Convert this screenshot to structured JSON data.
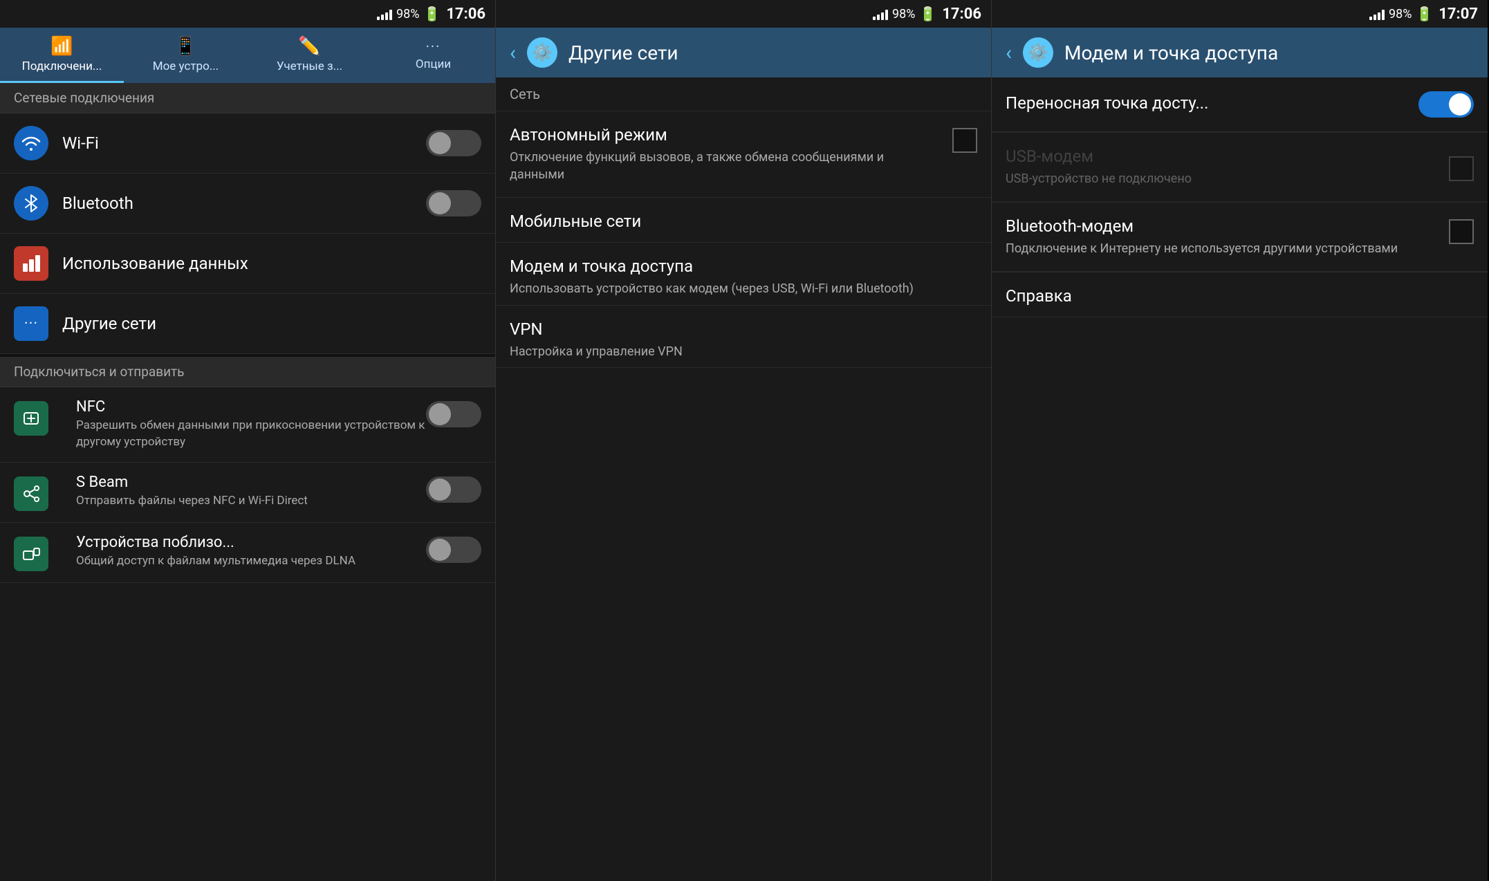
{
  "panel1": {
    "statusBar": {
      "battery": "98%",
      "time": "17:06"
    },
    "tabs": [
      {
        "label": "Подключени...",
        "icon": "📶",
        "active": true
      },
      {
        "label": "Мое устро...",
        "icon": "📱",
        "active": false
      },
      {
        "label": "Учетные з...",
        "icon": "✏️",
        "active": false
      },
      {
        "label": "Опции",
        "icon": "···",
        "active": false
      }
    ],
    "sectionHeader": "Сетевые подключения",
    "items": [
      {
        "title": "Wi-Fi",
        "toggle": true,
        "toggleOn": false
      },
      {
        "title": "Bluetooth",
        "toggle": true,
        "toggleOn": false
      }
    ],
    "dataItem": {
      "title": "Использование данных"
    },
    "otherItem": {
      "title": "Другие сети"
    },
    "connectSection": "Подключиться и отправить",
    "connectItems": [
      {
        "title": "NFC",
        "subtitle": "Разрешить обмен данными при прикосновении устройством к другому устройству",
        "toggle": true,
        "toggleOn": false
      },
      {
        "title": "S Beam",
        "subtitle": "Отправить файлы через NFC и Wi-Fi Direct",
        "toggle": true,
        "toggleOn": false
      },
      {
        "title": "Устройства поблизо...",
        "subtitle": "Общий доступ к файлам мультимедиа через DLNA",
        "toggle": true,
        "toggleOn": false
      }
    ]
  },
  "panel2": {
    "statusBar": {
      "battery": "98%",
      "time": "17:06"
    },
    "header": {
      "title": "Другие сети",
      "icon": "⚙️"
    },
    "sectionLabel": "Сеть",
    "items": [
      {
        "title": "Автономный режим",
        "subtitle": "Отключение функций вызовов, а также обмена сообщениями и данными",
        "hasCheckbox": true
      },
      {
        "title": "Мобильные сети",
        "subtitle": "",
        "hasCheckbox": false
      },
      {
        "title": "Модем и точка доступа",
        "subtitle": "Использовать устройство как модем (через USB, Wi-Fi или Bluetooth)",
        "hasCheckbox": false
      },
      {
        "title": "VPN",
        "subtitle": "Настройка и управление VPN",
        "hasCheckbox": false
      }
    ]
  },
  "panel3": {
    "statusBar": {
      "battery": "98%",
      "time": "17:07"
    },
    "header": {
      "title": "Модем и точка доступа",
      "icon": "⚙️"
    },
    "items": [
      {
        "title": "Переносная точка досту...",
        "subtitle": "",
        "toggleOn": true,
        "disabled": false
      },
      {
        "title": "USB-модем",
        "subtitle": "USB-устройство не подключено",
        "hasCheckbox": true,
        "disabled": true
      },
      {
        "title": "Bluetooth-модем",
        "subtitle": "Подключение к Интернету не используется другими устройствами",
        "hasCheckbox": true,
        "disabled": false
      },
      {
        "title": "Справка",
        "subtitle": "",
        "hasCheckbox": false,
        "disabled": false
      }
    ]
  }
}
